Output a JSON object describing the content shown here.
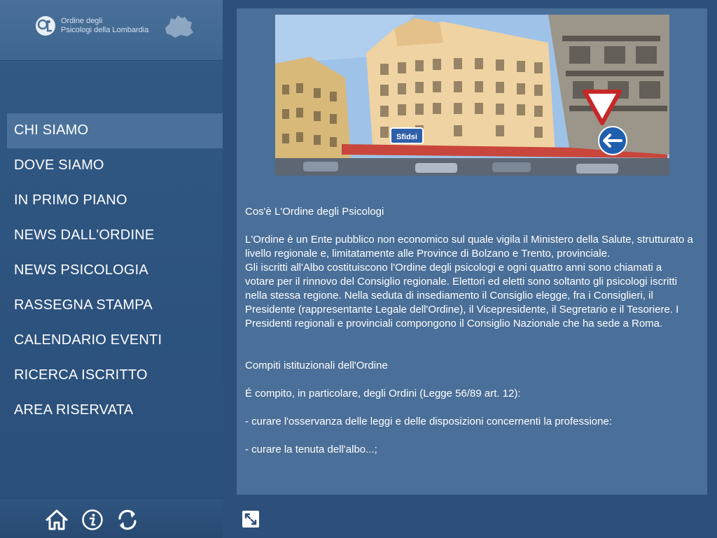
{
  "logo": {
    "line1": "Ordine degli",
    "line2": "Psicologi della Lombardia"
  },
  "menu": {
    "items": [
      {
        "label": "CHI SIAMO",
        "active": true
      },
      {
        "label": "DOVE SIAMO"
      },
      {
        "label": "IN PRIMO PIANO"
      },
      {
        "label": "NEWS DALL'ORDINE"
      },
      {
        "label": "NEWS PSICOLOGIA"
      },
      {
        "label": "RASSEGNA STAMPA"
      },
      {
        "label": "CALENDARIO EVENTI"
      },
      {
        "label": "RICERCA ISCRITTO"
      },
      {
        "label": "AREA RISERVATA"
      }
    ]
  },
  "footer_icons": [
    "home-icon",
    "info-icon",
    "refresh-icon"
  ],
  "main_footer_icons": [
    "expand-icon"
  ],
  "hero": {
    "sign_text": "Sfidsi",
    "description": "Illustrated Milan street with historic building"
  },
  "article": {
    "title": "Cos'è L'Ordine degli Psicologi",
    "para1": "L'Ordine è un Ente pubblico non economico sul quale vigila il Ministero della Salute, strutturato a livello regionale e, limitatamente alle Province di Bolzano e Trento, provinciale.",
    "para2": "Gli iscritti all'Albo costituiscono l'Ordine degli psicologi e ogni quattro anni sono chiamati a votare per il rinnovo del Consiglio regionale. Elettori ed eletti sono soltanto gli psicologi iscritti nella stessa regione. Nella seduta di insediamento il Consiglio elegge, fra i Consiglieri, il Presidente (rappresentante Legale dell'Ordine), il Vicepresidente, il Segretario e il Tesoriere. I Presidenti regionali e provinciali compongono il Consiglio Nazionale che ha sede a Roma.",
    "heading2": "Compiti istituzionali dell'Ordine",
    "para3": "É compito, in particolare, degli Ordini (Legge 56/89 art. 12):",
    "bullet1": "- curare l'osservanza delle leggi e delle disposizioni concernenti la professione:",
    "bullet2": "- curare la tenuta dell'albo...;"
  },
  "colors": {
    "sidebar_bg": "#2e5480",
    "active_item_bg": "#4b719b",
    "panel_bg": "#4a6f98",
    "text": "#ffffff"
  }
}
